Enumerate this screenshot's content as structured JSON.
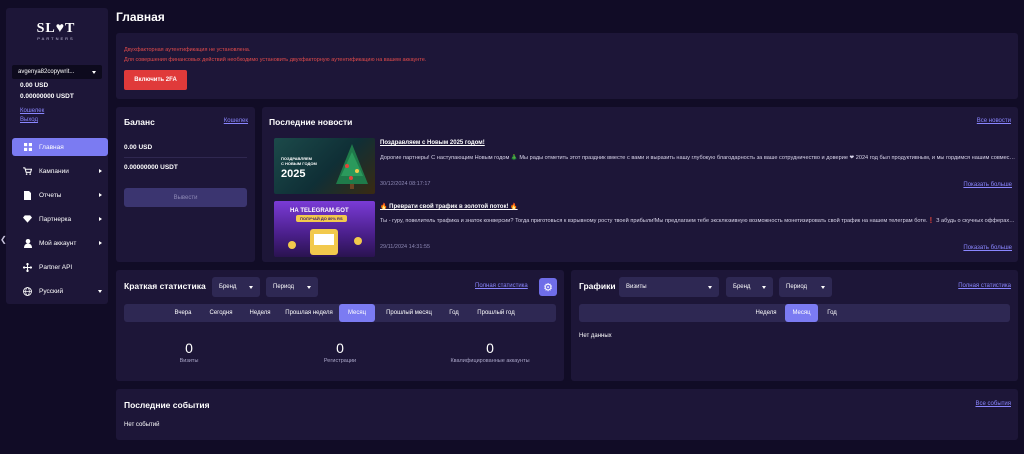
{
  "brand": {
    "logo_text": "SL♥T",
    "logo_sub": "PARTNERS"
  },
  "sidebar": {
    "account": "avgenya82copywrit...",
    "balance_usd": "0.00  USD",
    "balance_usdt": "0.00000000  USDT",
    "wallet_link": "Кошелек",
    "logout_link": "Выход",
    "items": [
      {
        "label": "Главная",
        "icon": "home-icon"
      },
      {
        "label": "Кампании",
        "icon": "shopping-cart-icon"
      },
      {
        "label": "Отчеты",
        "icon": "file-icon"
      },
      {
        "label": "Партнерка",
        "icon": "diamond-icon"
      },
      {
        "label": "Мой аккаунт",
        "icon": "user-icon"
      },
      {
        "label": "Partner API",
        "icon": "api-icon"
      },
      {
        "label": "Русский",
        "icon": "globe-icon"
      }
    ]
  },
  "page": {
    "title": "Главная"
  },
  "alert": {
    "line1": "Двухфакторная аутентификация не установлена.",
    "line2": "Для совершения финансовых действий необходимо установить двухфакторную аутентификацию на вашем аккаунте.",
    "button": "Включить 2FA"
  },
  "balance": {
    "title": "Баланс",
    "link": "Кошелек",
    "usd": "0.00  USD",
    "usdt": "0.00000000  USDT",
    "button": "Вывести"
  },
  "news": {
    "title": "Последние новости",
    "all_link": "Все новости",
    "items": [
      {
        "title": "Поздравляем с Новым 2025 годом!",
        "body": "Дорогие партнеры! С наступающим Новым годом 🎄 Мы рады отметить этот праздник вместе с вами и выразить нашу глубокую благодарность за ваше сотрудничество и доверие ❤ 2024 год был продуктивным, и мы гордимся нашим совместным успехом. В новом году мы планируем сделать сотрудничество еще более прибыльным, добавляя новые условия сотрудничества, бонусы и подарки для всех наших партнеров 🎄 П...",
        "date": "30/12/2024 08:17:17",
        "more": "Показать больше",
        "img_line1": "ПОЗДРАВЛЯЕМ",
        "img_line2": "С НОВЫМ ГОДОМ",
        "img_year": "2025"
      },
      {
        "title": "🔥 Преврати свой трафик в золотой поток! 🔥",
        "body": "Ты - гуру, повелитель трафика и знаток конверсии? Тогда приготовься к взрывному росту твоей прибыли!Мы предлагаем тебе эксклюзивную возможность монетизировать свой трафик на нашем телеграм боте.❗ З абудь о скучных офферах и низкой конверсии❗🤖 Наш телеграм бот - это целый мир азарта и больших выигрышей, который мгновенно захватывает внимание пользователей. Мы предлагаем: ⚡ Высокую конве...",
        "date": "29/11/2024 14:31:55",
        "more": "Показать больше",
        "img_line1": "НА TELEGRAM-БОТ",
        "img_line2": "ПОЛУЧАЙ ДО 80% RS"
      }
    ]
  },
  "stats": {
    "title": "Краткая статистика",
    "brand_dd": "Бренд",
    "period_dd": "Период",
    "full_link": "Полная статистика",
    "tabs": [
      "Вчера",
      "Сегодня",
      "Неделя",
      "Прошлая неделя",
      "Месяц",
      "Прошлый месяц",
      "Год",
      "Прошлый год"
    ],
    "active_tab": "Месяц",
    "metrics": [
      {
        "value": "0",
        "label": "Визиты"
      },
      {
        "value": "0",
        "label": "Регистрации"
      },
      {
        "value": "0",
        "label": "Квалифицированные аккаунты"
      }
    ]
  },
  "graphs": {
    "title": "Графики",
    "metric_dd": "Визиты",
    "brand_dd": "Бренд",
    "period_dd": "Период",
    "full_link": "Полная статистика",
    "tabs": [
      "Неделя",
      "Месяц",
      "Год"
    ],
    "active_tab": "Месяц",
    "empty": "Нет данных"
  },
  "events": {
    "title": "Последние события",
    "all_link": "Все события",
    "empty": "Нет событий"
  },
  "colors": {
    "accent": "#7b7bf2",
    "danger": "#e03a3a",
    "panel": "#1d1638",
    "bg": "#110c26",
    "link": "#8a86ff"
  }
}
